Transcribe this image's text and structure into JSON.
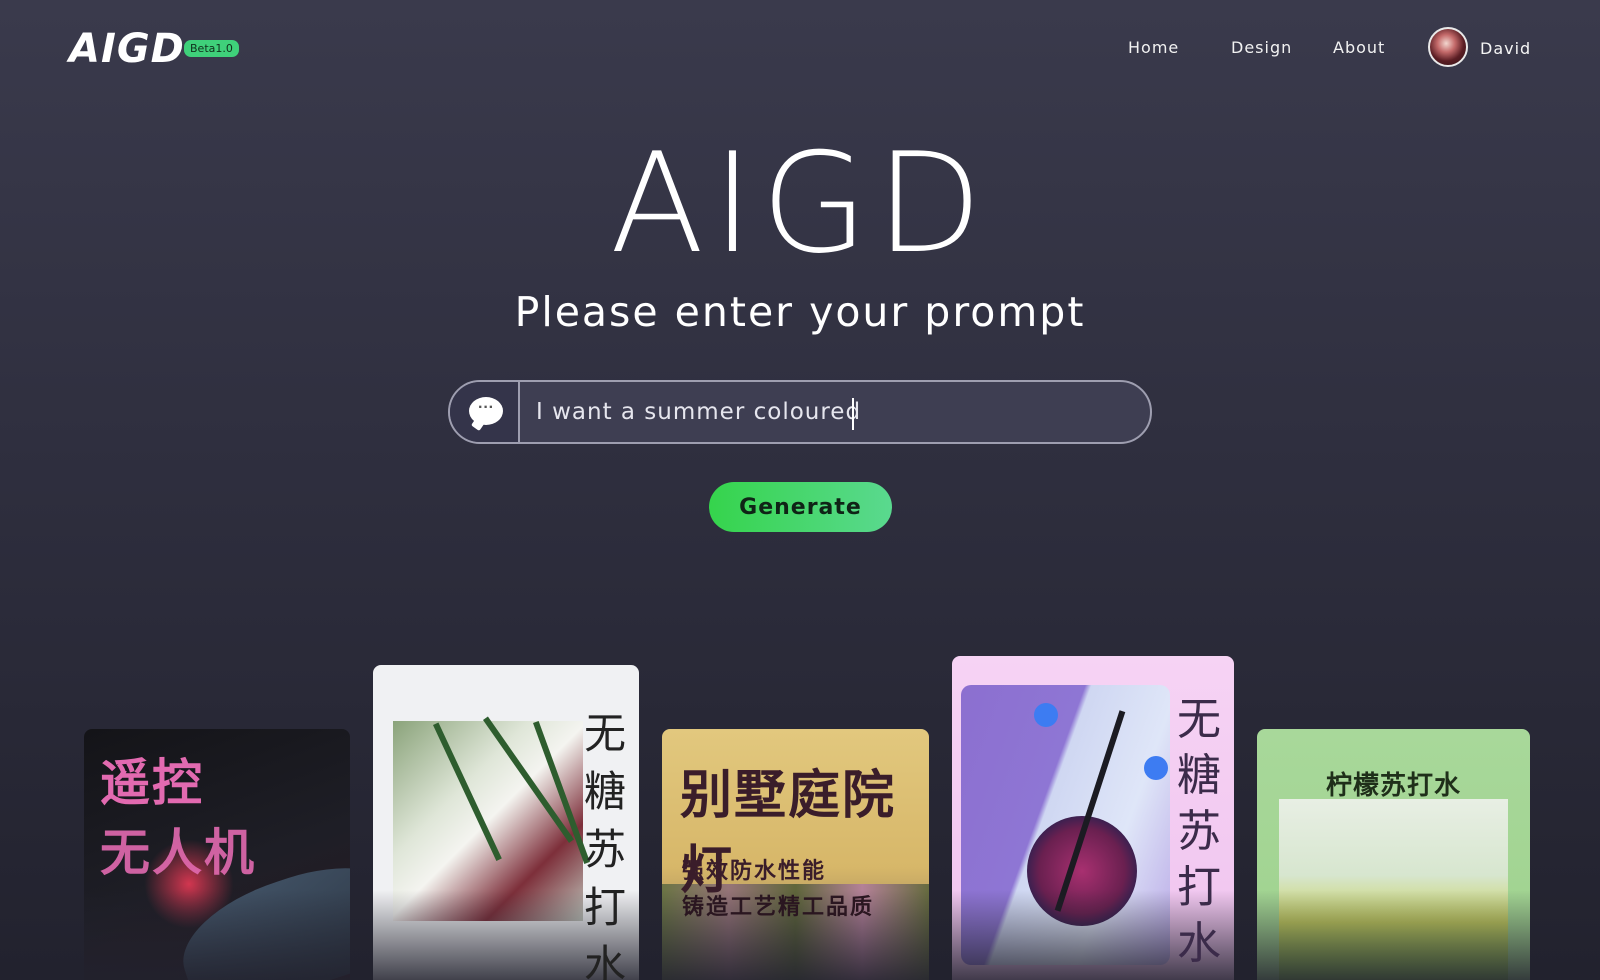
{
  "header": {
    "logo": "AIGD",
    "badge": "Beta1.0",
    "nav": [
      "Home",
      "Design",
      "About"
    ],
    "user_name": "David"
  },
  "hero": {
    "title": "AIGD",
    "subtitle": "Please enter your prompt",
    "prompt_value": "I want a summer coloured",
    "generate_label": "Generate"
  },
  "cards": [
    {
      "line1": "遥控",
      "line2": "无人机"
    },
    {
      "vertical": "无糖苏打水"
    },
    {
      "title": "别墅庭院灯",
      "sub1": "强效防水性能",
      "sub2": "铸造工艺精工品质"
    },
    {
      "vertical": "无糖苏打水"
    },
    {
      "title": "柠檬苏打水"
    }
  ],
  "colors": {
    "accent": "#3fd07a",
    "background": "#2f2f3f"
  }
}
